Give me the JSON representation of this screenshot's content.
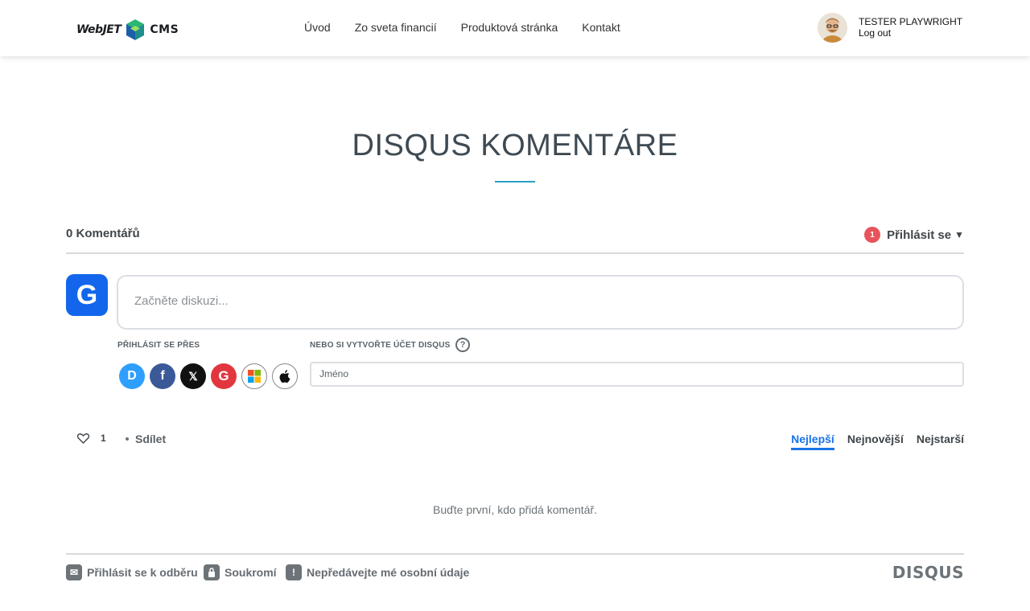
{
  "header": {
    "logo_left": "WebJET",
    "logo_right": "CMS",
    "nav": [
      "Úvod",
      "Zo sveta financií",
      "Produktová stránka",
      "Kontakt"
    ],
    "user_name": "TESTER PLAYWRIGHT",
    "logout": "Log out"
  },
  "page": {
    "title": "DISQUS KOMENTÁRE"
  },
  "disqus": {
    "comment_count": "0 Komentářů",
    "notification_count": "1",
    "login_label": "Přihlásit se",
    "user_initial": "G",
    "comment_placeholder": "Začněte diskuzi...",
    "login_via": "PŘIHLÁSIT SE PŘES",
    "or_create": "NEBO SI VYTVOŘTE ÚČET DISQUS",
    "help": "?",
    "name_placeholder": "Jméno",
    "social_icons": [
      "disqus-icon",
      "facebook-icon",
      "x-icon",
      "google-icon",
      "microsoft-icon",
      "apple-icon"
    ],
    "likes": "1",
    "share": "Sdílet",
    "sort": [
      "Nejlepší",
      "Nejnovější",
      "Nejstarší"
    ],
    "sort_active": "Nejlepší",
    "empty_text": "Buďte první, kdo přidá komentář.",
    "footer": {
      "subscribe": "Přihlásit se k odběru",
      "privacy": "Soukromí",
      "do_not_sell": "Nepředávejte mé osobní údaje",
      "logo": "DISQUS"
    }
  },
  "colors": {
    "accent": "#1a73e8",
    "title_line": "#2aa1c0",
    "badge": "#e8535b",
    "user_avatar": "#1366ec"
  }
}
